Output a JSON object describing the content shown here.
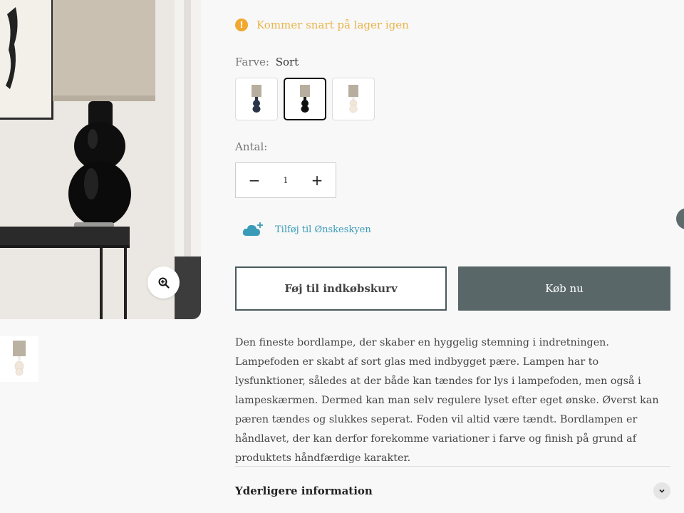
{
  "stock_notice": {
    "icon": "exclamation-icon",
    "text": "Kommer snart på lager igen"
  },
  "color": {
    "label": "Farve:",
    "selected": "Sort",
    "swatches": [
      {
        "name": "navy-swatch",
        "base_color": "#2a3548"
      },
      {
        "name": "black-swatch",
        "base_color": "#111111"
      },
      {
        "name": "clear-swatch",
        "base_color": "#eae0d8"
      }
    ]
  },
  "quantity": {
    "label": "Antal:",
    "value": "1",
    "minus": "−",
    "plus": "+"
  },
  "wishlist": {
    "label": "Tilføj til Ønskeskyen",
    "icon": "cloud-plus-icon"
  },
  "buttons": {
    "add_to_cart": "Føj til indkøbskurv",
    "buy_now": "Køb nu"
  },
  "description": "Den fineste bordlampe, der skaber en hyggelig stemning i indretningen. Lampefoden er skabt af sort glas med indbygget pære. Lampen har to lysfunktioner, således at der både kan tændes for lys i lampefoden, men også i lampeskærmen. Dermed kan man selv regulere lyset efter eget ønske. Øverst kan pæren tændes og slukkes seperat. Foden vil altid være tændt. Bordlampen er håndlavet, der kan derfor forekomme variationer i farve og finish på grund af produktets håndfærdige karakter.",
  "more_info": {
    "title": "Yderligere information",
    "icon": "chevron-down-icon"
  },
  "colors": {
    "accent_orange": "#f0a830",
    "stock_text": "#e8b44a",
    "wishlist_blue": "#3a9bb8",
    "buy_button": "#5a6769"
  }
}
